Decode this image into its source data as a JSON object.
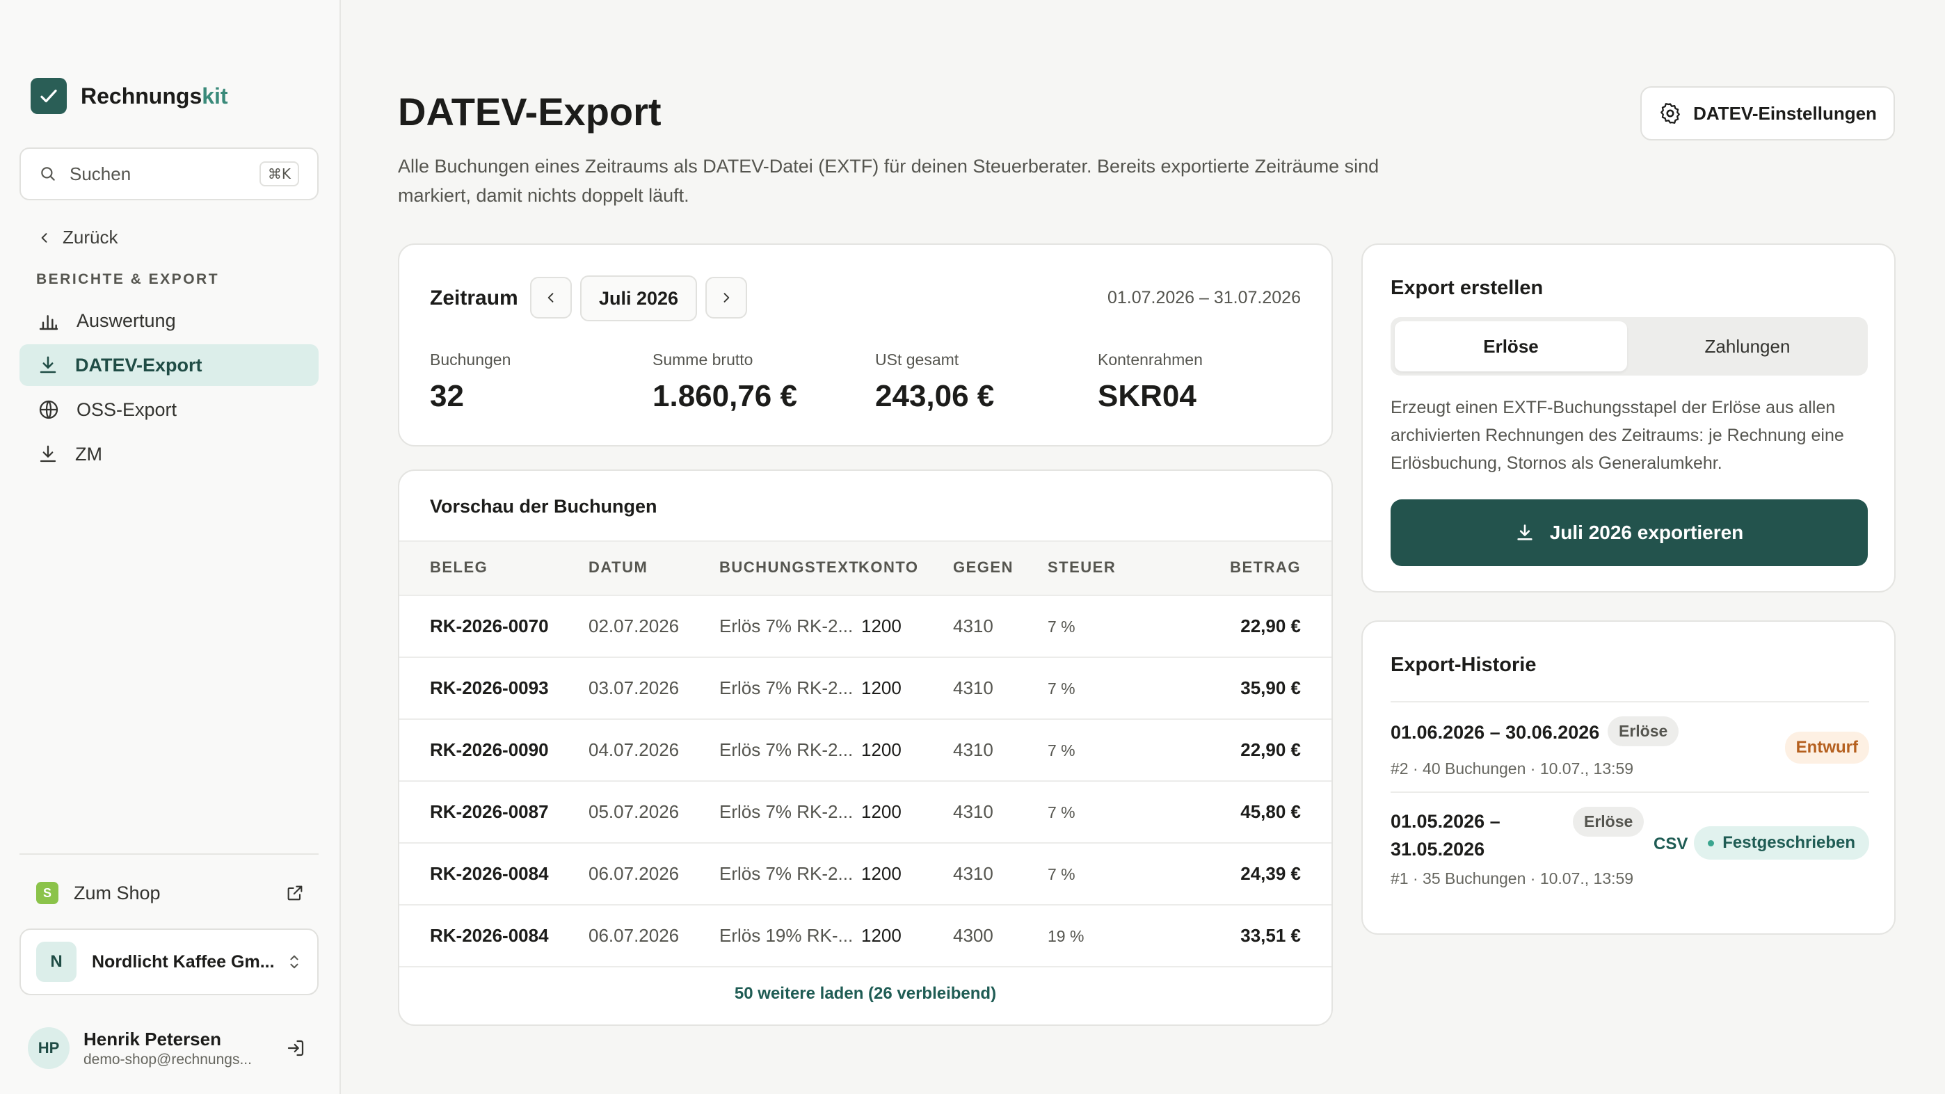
{
  "sidebar": {
    "brand": {
      "name_main": "Rechnungs",
      "name_accent": "kit"
    },
    "search": {
      "label": "Suchen",
      "shortcut": "⌘K"
    },
    "back_label": "Zurück",
    "section_title": "BERICHTE & EXPORT",
    "items": [
      {
        "label": "Auswertung",
        "icon": "bar-chart-icon",
        "active": false
      },
      {
        "label": "DATEV-Export",
        "icon": "download-icon",
        "active": true
      },
      {
        "label": "OSS-Export",
        "icon": "globe-icon",
        "active": false
      },
      {
        "label": "ZM",
        "icon": "download-icon",
        "active": false
      }
    ],
    "shop": {
      "badge": "S",
      "label": "Zum Shop"
    },
    "org": {
      "initial": "N",
      "name": "Nordlicht Kaffee Gm..."
    },
    "user": {
      "initials": "HP",
      "name": "Henrik Petersen",
      "email": "demo-shop@rechnungs..."
    }
  },
  "header": {
    "title": "DATEV-Export",
    "description": "Alle Buchungen eines Zeitraums als DATEV-Datei (EXTF) für deinen Steuerberater. Bereits exportierte Zeiträume sind markiert, damit nichts doppelt läuft.",
    "settings_label": "DATEV-Einstellungen"
  },
  "period": {
    "label": "Zeitraum",
    "month": "Juli 2026",
    "range": "01.07.2026 – 31.07.2026",
    "stats": [
      {
        "label": "Buchungen",
        "value": "32"
      },
      {
        "label": "Summe brutto",
        "value": "1.860,76 €"
      },
      {
        "label": "USt gesamt",
        "value": "243,06 €"
      },
      {
        "label": "Kontenrahmen",
        "value": "SKR04"
      }
    ]
  },
  "preview": {
    "title": "Vorschau der Buchungen",
    "columns": [
      "BELEG",
      "DATUM",
      "BUCHUNGSTEXT",
      "KONTO",
      "GEGEN",
      "STEUER",
      "BETRAG"
    ],
    "rows": [
      {
        "beleg": "RK-2026-0070",
        "datum": "02.07.2026",
        "text": "Erlös 7% RK-2...",
        "konto": "1200",
        "gegen": "4310",
        "steuer": "7 %",
        "betrag": "22,90 €"
      },
      {
        "beleg": "RK-2026-0093",
        "datum": "03.07.2026",
        "text": "Erlös 7% RK-2...",
        "konto": "1200",
        "gegen": "4310",
        "steuer": "7 %",
        "betrag": "35,90 €"
      },
      {
        "beleg": "RK-2026-0090",
        "datum": "04.07.2026",
        "text": "Erlös 7% RK-2...",
        "konto": "1200",
        "gegen": "4310",
        "steuer": "7 %",
        "betrag": "22,90 €"
      },
      {
        "beleg": "RK-2026-0087",
        "datum": "05.07.2026",
        "text": "Erlös 7% RK-2...",
        "konto": "1200",
        "gegen": "4310",
        "steuer": "7 %",
        "betrag": "45,80 €"
      },
      {
        "beleg": "RK-2026-0084",
        "datum": "06.07.2026",
        "text": "Erlös 7% RK-2...",
        "konto": "1200",
        "gegen": "4310",
        "steuer": "7 %",
        "betrag": "24,39 €"
      },
      {
        "beleg": "RK-2026-0084",
        "datum": "06.07.2026",
        "text": "Erlös 19% RK-...",
        "konto": "1200",
        "gegen": "4300",
        "steuer": "19 %",
        "betrag": "33,51 €"
      }
    ],
    "load_more": "50 weitere laden (26 verbleibend)"
  },
  "export": {
    "title": "Export erstellen",
    "tabs": [
      {
        "label": "Erlöse",
        "active": true
      },
      {
        "label": "Zahlungen",
        "active": false
      }
    ],
    "description": "Erzeugt einen EXTF-Buchungsstapel der Erlöse aus allen archivierten Rechnungen des Zeitraums: je Rechnung eine Erlösbuchung, Stornos als Generalumkehr.",
    "button_label": "Juli 2026 exportieren"
  },
  "history": {
    "title": "Export-Historie",
    "items": [
      {
        "range": "01.06.2026 – 30.06.2026",
        "type": "Erlöse",
        "meta": "#2 · 40 Buchungen · 10.07., 13:59",
        "status": "Entwurf"
      },
      {
        "range_line1": "01.05.2026 –",
        "range_line2": "31.05.2026",
        "type": "Erlöse",
        "format": "CSV",
        "meta": "#1 · 35 Buchungen · 10.07., 13:59",
        "status": "Festgeschrieben"
      }
    ]
  },
  "colors": {
    "accent": "#23534d",
    "active_nav_bg": "#dceeea",
    "draft": "#b5601f",
    "committed": "#1f5c54"
  }
}
